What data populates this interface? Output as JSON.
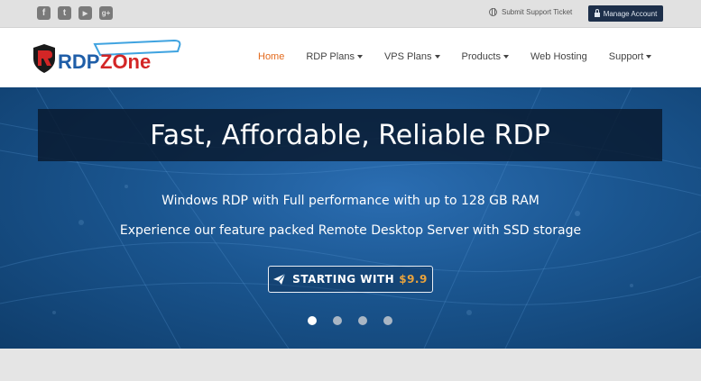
{
  "topbar": {
    "social": [
      {
        "icon": "facebook-icon",
        "glyph": "f"
      },
      {
        "icon": "twitter-icon",
        "glyph": "t"
      },
      {
        "icon": "youtube-icon",
        "glyph": "▶"
      },
      {
        "icon": "google-plus-icon",
        "glyph": "g+"
      }
    ],
    "support_ticket": "Submit Support Ticket",
    "manage_account": "Manage Account"
  },
  "header": {
    "logo": {
      "text_a": "RDP",
      "text_b": "ZOne"
    },
    "nav": [
      {
        "label": "Home",
        "active": true,
        "dropdown": false
      },
      {
        "label": "RDP Plans",
        "active": false,
        "dropdown": true
      },
      {
        "label": "VPS Plans",
        "active": false,
        "dropdown": true
      },
      {
        "label": "Products",
        "active": false,
        "dropdown": true
      },
      {
        "label": "Web Hosting",
        "active": false,
        "dropdown": false
      },
      {
        "label": "Support",
        "active": false,
        "dropdown": true
      }
    ]
  },
  "hero": {
    "title": "Fast, Affordable, Reliable RDP",
    "line1": "Windows RDP with Full performance with up to 128 GB RAM",
    "line2": "Experience our feature packed Remote Desktop Server with SSD storage",
    "cta_label": "STARTING WITH",
    "cta_price": "$9.9",
    "slides": 4,
    "active_slide": 1
  },
  "colors": {
    "accent": "#e36a1d",
    "button_dark": "#1d2f4a",
    "price": "#e8a33d"
  }
}
